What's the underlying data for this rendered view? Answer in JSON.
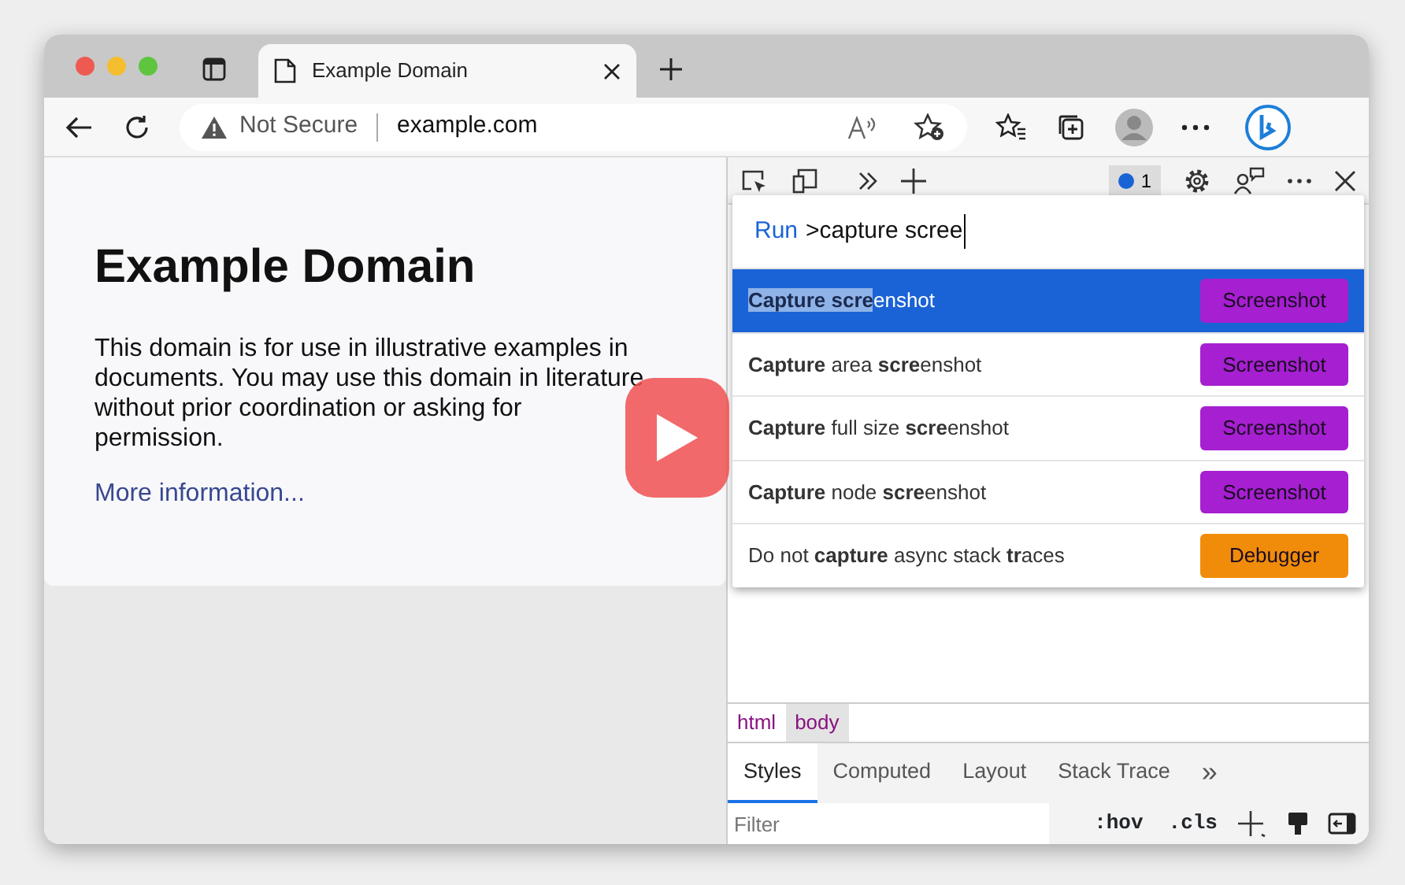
{
  "tabs": [
    {
      "title": "Example Domain",
      "selected": true
    }
  ],
  "address": {
    "security": "Not Secure",
    "url": "example.com"
  },
  "page": {
    "heading": "Example Domain",
    "paragraph": "This domain is for use in illustrative examples in documents. You may use this domain in literature without prior coordination or asking for permission.",
    "link": "More information..."
  },
  "video": {
    "kind": "play-button"
  },
  "devtools": {
    "issues_count": "1",
    "command_menu": {
      "prefix": "Run",
      "query": ">capture scree",
      "items": [
        {
          "label": "**Capture scre**enshot",
          "tag": "Screenshot",
          "color": "#a61fd0",
          "selected": true
        },
        {
          "label": "**Capture** area **scre**enshot",
          "tag": "Screenshot",
          "color": "#a61fd0",
          "selected": false
        },
        {
          "label": "**Capture** full size **scre**enshot",
          "tag": "Screenshot",
          "color": "#a61fd0",
          "selected": false
        },
        {
          "label": "**Capture** node **scre**enshot",
          "tag": "Screenshot",
          "color": "#a61fd0",
          "selected": false
        },
        {
          "label": "Do not **capture** async stack **tr**aces",
          "tag": "Debugger",
          "color": "#f08c0a",
          "selected": false
        }
      ]
    },
    "breadcrumbs": [
      {
        "label": "html",
        "selected": false
      },
      {
        "label": "body",
        "selected": true
      }
    ],
    "panel_tabs": [
      {
        "label": "Styles",
        "selected": true
      },
      {
        "label": "Computed",
        "selected": false
      },
      {
        "label": "Layout",
        "selected": false
      },
      {
        "label": "Stack Trace",
        "selected": false
      }
    ],
    "more_tabs": "»",
    "filter": {
      "placeholder": "Filter"
    },
    "style_actions": [
      ":hov",
      ".cls"
    ]
  }
}
